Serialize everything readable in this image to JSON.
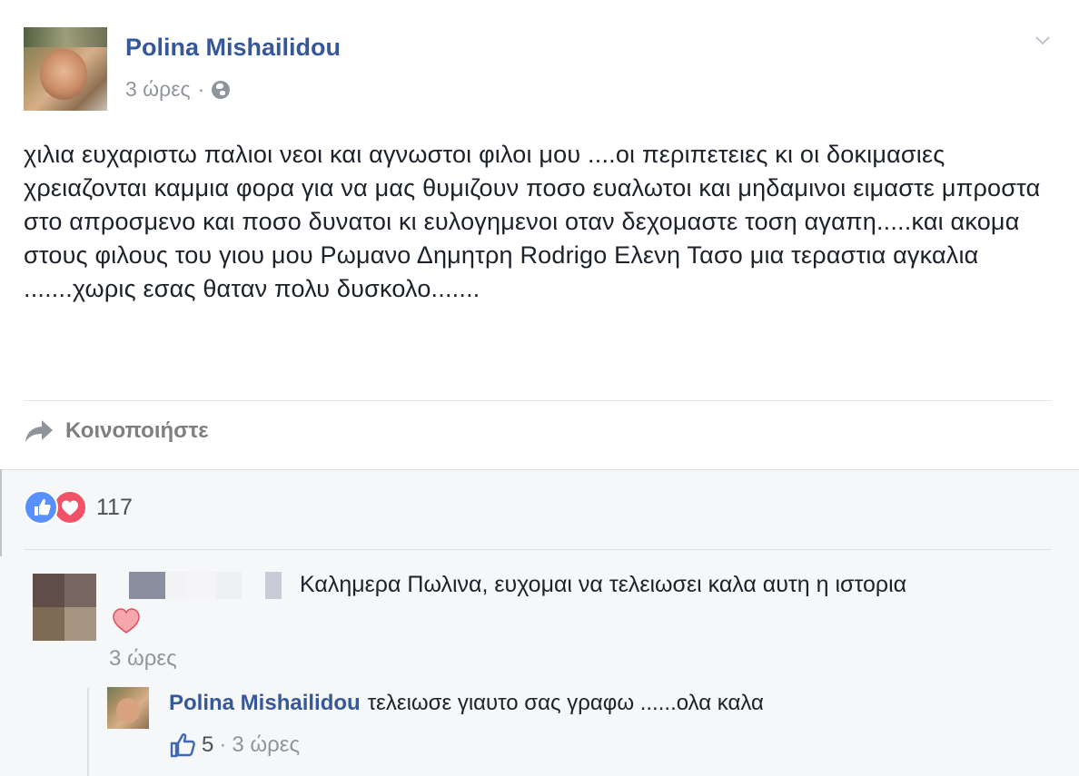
{
  "post": {
    "author": "Polina Mishailidou",
    "time": "3 ώρες",
    "separator": "·",
    "privacy_icon": "globe-icon",
    "options_icon": "chevron-down-icon",
    "text": "χιλια ευχαριστω παλιοι νεοι και αγνωστοι φιλοι μου ....οι περιπετειες κι οι δοκιμασιες χρειαζονται καμμια φορα για να μας θυμιζουν ποσο ευαλωτοι και μηδαμινοι ειμαστε μπροστα στο απροσμενο και ποσο δυνατοι κι ευλογημενοι οταν δεχομαστε τοση αγαπη.....και ακομα στους φιλους του γιου μου Ρωμανο Δημητρη Rodrigo Ελενη Τασο μια τεραστια αγκαλια .......χωρις εσας θαταν πολυ δυσκολο.......",
    "share_label": "Κοινοποιήστε"
  },
  "reactions": {
    "types": [
      "like",
      "love"
    ],
    "count": "117"
  },
  "comments": [
    {
      "author_hidden": true,
      "text": "Καλημερα Πωλινα, ευχομαι να τελειωσει καλα αυτη η ιστορια",
      "emoji": "heart",
      "time": "3 ώρες"
    }
  ],
  "reply": {
    "author": "Polina Mishailidou",
    "text": "τελειωσε γιαυτο σας γραφω ......ολα καλα",
    "likes": "5",
    "separator": "·",
    "time": "3 ώρες"
  },
  "colors": {
    "link_blue": "#365899",
    "meta_gray": "#90949c",
    "like_blue": "#5890ff",
    "love_red": "#f25268",
    "feedback_bg": "#f6f7f9"
  }
}
